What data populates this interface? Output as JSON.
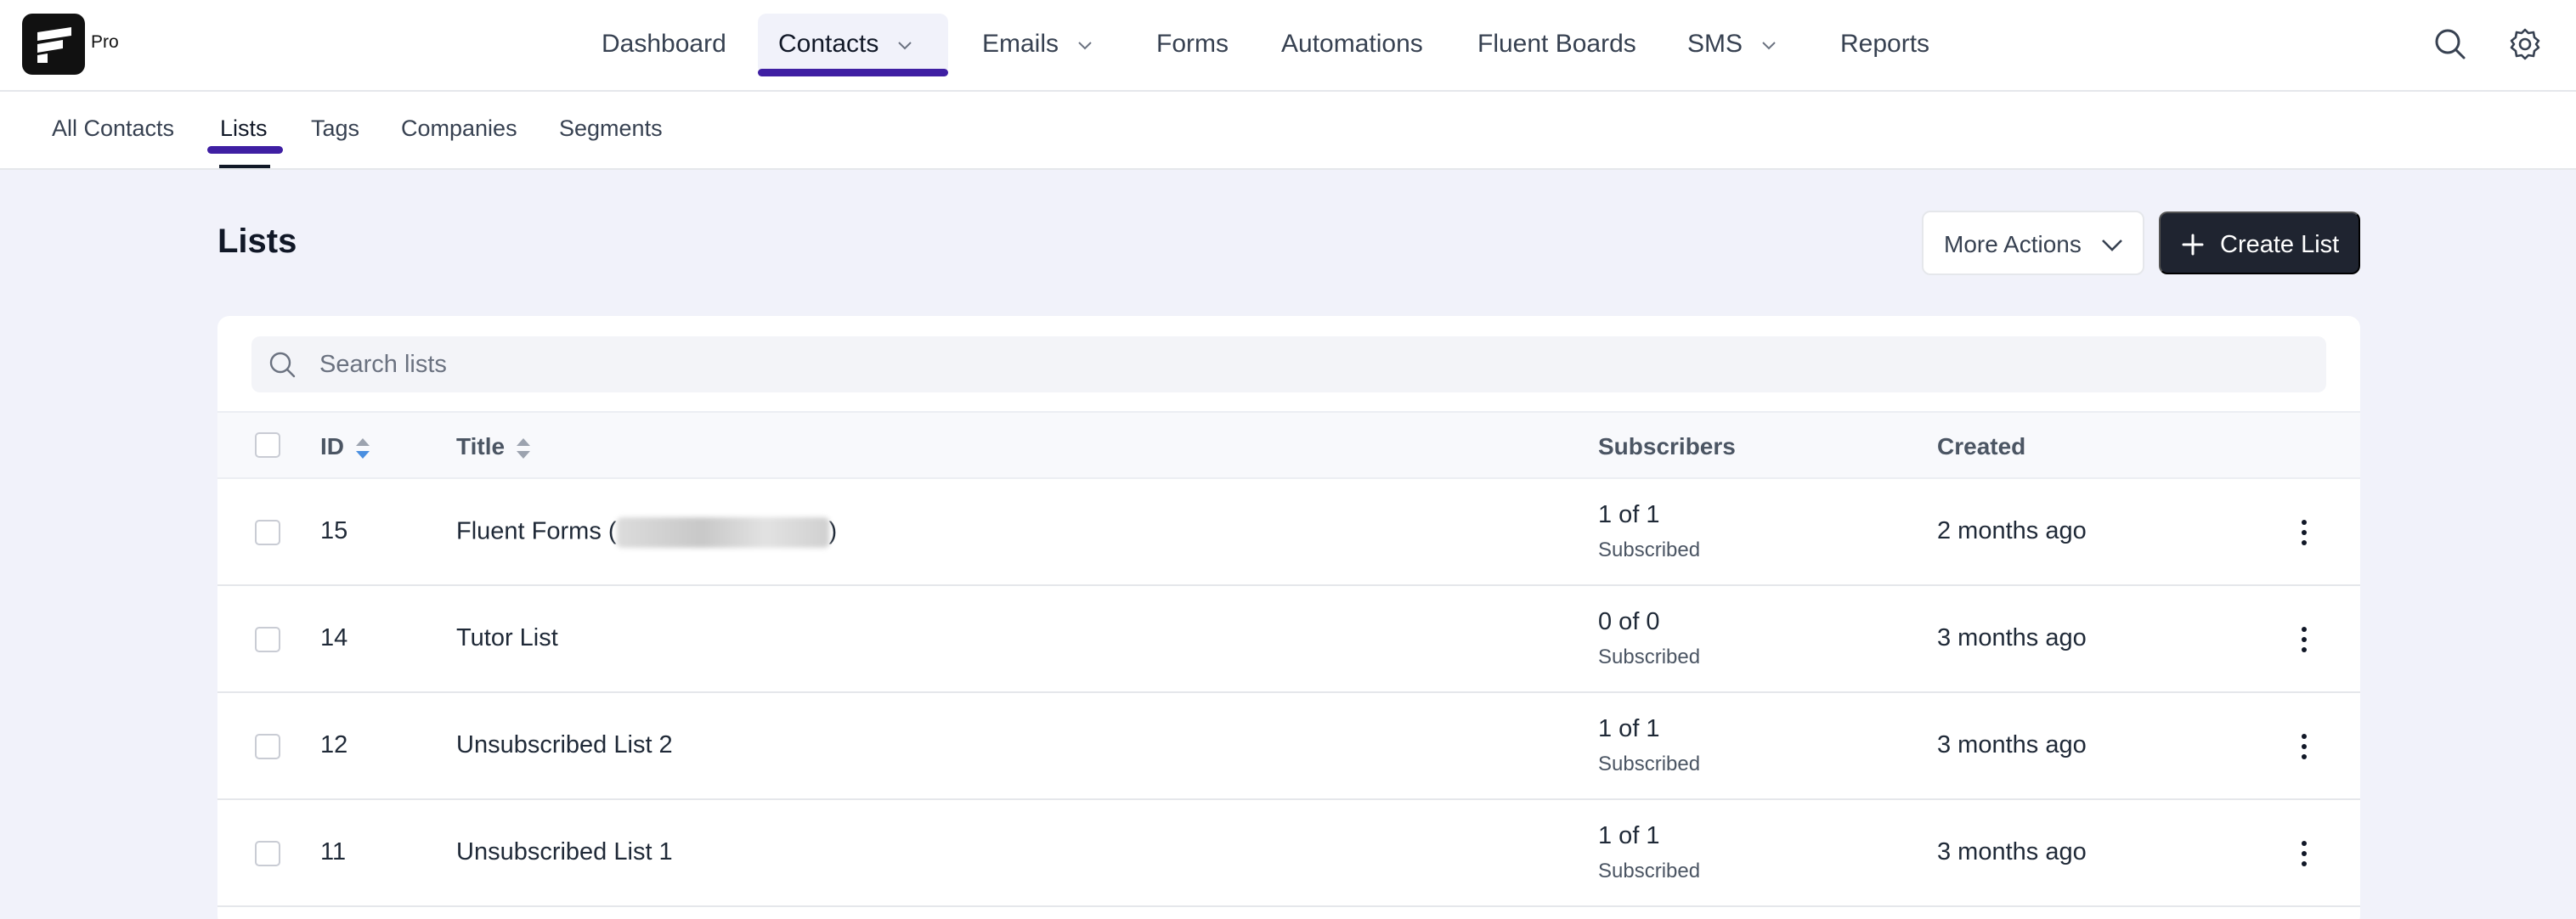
{
  "app": {
    "badge": "Pro"
  },
  "nav": {
    "dashboard": "Dashboard",
    "contacts": "Contacts",
    "emails": "Emails",
    "forms": "Forms",
    "automations": "Automations",
    "fluent_boards": "Fluent Boards",
    "sms": "SMS",
    "reports": "Reports",
    "active": "Contacts"
  },
  "subnav": {
    "all_contacts": "All Contacts",
    "lists": "Lists",
    "tags": "Tags",
    "companies": "Companies",
    "segments": "Segments",
    "active": "Lists"
  },
  "page": {
    "title": "Lists",
    "more_actions": "More Actions",
    "create_list": "Create List"
  },
  "search": {
    "placeholder": "Search lists",
    "value": ""
  },
  "table": {
    "headers": {
      "id": "ID",
      "title": "Title",
      "subscribers": "Subscribers",
      "created": "Created"
    },
    "rows": [
      {
        "id": "15",
        "title_prefix": "Fluent Forms (",
        "title_suffix": ")",
        "count": "1 of 1",
        "status": "Subscribed",
        "created": "2 months ago"
      },
      {
        "id": "14",
        "title": "Tutor List",
        "count": "0 of 0",
        "status": "Subscribed",
        "created": "3 months ago"
      },
      {
        "id": "12",
        "title": "Unsubscribed List 2",
        "count": "1 of 1",
        "status": "Subscribed",
        "created": "3 months ago"
      },
      {
        "id": "11",
        "title": "Unsubscribed List 1",
        "count": "1 of 1",
        "status": "Subscribed",
        "created": "3 months ago"
      }
    ]
  },
  "icons": {
    "search": "search-icon",
    "settings": "gear-icon",
    "chevron": "chevron-down-icon",
    "plus": "plus-icon",
    "more": "kebab-icon"
  },
  "colors": {
    "accent": "#3f1fa3",
    "primary_button": "#1f2430",
    "page_background": "#f1f2fa",
    "sort_active": "#4a8fe0"
  }
}
